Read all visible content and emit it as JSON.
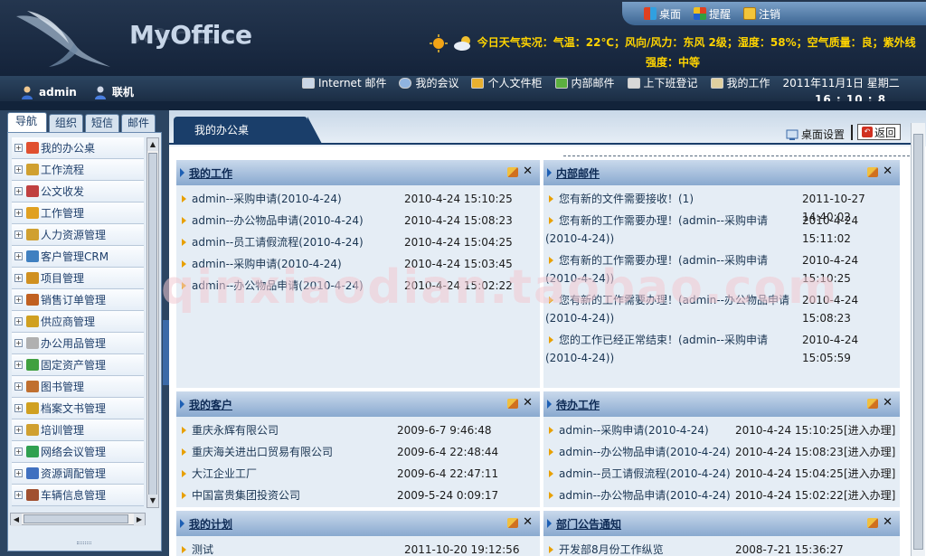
{
  "header": {
    "logo_text": "MyOffice",
    "top_links": {
      "desktop": "桌面",
      "reminder": "提醒",
      "logout": "注销"
    },
    "weather": "今日天气实况：气温：22℃；风向/风力：东风 2级；湿度：58%；空气质量：良；紫外线强度：中等"
  },
  "navbar": {
    "username": "admin",
    "status": "联机",
    "links": [
      "Internet 邮件",
      "我的会议",
      "个人文件柜",
      "内部邮件",
      "上下班登记",
      "我的工作"
    ],
    "date": "2011年11月1日 星期二",
    "clock": "16 : 10 : 8"
  },
  "sidebar": {
    "tabs": [
      "导航",
      "组织",
      "短信",
      "邮件"
    ],
    "modules": [
      "我的办公桌",
      "工作流程",
      "公文收发",
      "工作管理",
      "人力资源管理",
      "客户管理CRM",
      "项目管理",
      "销售订单管理",
      "供应商管理",
      "办公用品管理",
      "固定资产管理",
      "图书管理",
      "档案文书管理",
      "培训管理",
      "网络会议管理",
      "资源调配管理",
      "车辆信息管理"
    ]
  },
  "main": {
    "tab_title": "我的办公桌",
    "desk_settings": "桌面设置",
    "back": "返回",
    "panels": {
      "my_work": {
        "title": "我的工作",
        "rows": [
          {
            "text": "admin--采购申请(2010-4-24)",
            "time": "2010-4-24 15:10:25"
          },
          {
            "text": "admin--办公物品申请(2010-4-24)",
            "time": "2010-4-24 15:08:23"
          },
          {
            "text": "admin--员工请假流程(2010-4-24)",
            "time": "2010-4-24 15:04:25"
          },
          {
            "text": "admin--采购申请(2010-4-24)",
            "time": "2010-4-24 15:03:45"
          },
          {
            "text": "admin--办公物品申请(2010-4-24)",
            "time": "2010-4-24 15:02:22"
          }
        ]
      },
      "internal_mail": {
        "title": "内部邮件",
        "rows": [
          {
            "text": "您有新的文件需要接收！(1)",
            "time": "2011-10-27 14:40:02"
          },
          {
            "text": "您有新的工作需要办理！(admin--采购申请(2010-4-24))",
            "time": "2010-4-24 15:11:02"
          },
          {
            "text": "您有新的工作需要办理！(admin--采购申请(2010-4-24))",
            "time": "2010-4-24 15:10:25"
          },
          {
            "text": "您有新的工作需要办理！(admin--办公物品申请(2010-4-24))",
            "time": "2010-4-24 15:08:23"
          },
          {
            "text": "您的工作已经正常结束！(admin--采购申请(2010-4-24))",
            "time": "2010-4-24 15:05:59"
          }
        ]
      },
      "my_customers": {
        "title": "我的客户",
        "rows": [
          {
            "text": "重庆永辉有限公司",
            "time": "2009-6-7 9:46:48"
          },
          {
            "text": "重庆海关进出口贸易有限公司",
            "time": "2009-6-4 22:48:44"
          },
          {
            "text": "大江企业工厂",
            "time": "2009-6-4 22:47:11"
          },
          {
            "text": "中国富贵集团投资公司",
            "time": "2009-5-24 0:09:17"
          }
        ]
      },
      "todo": {
        "title": "待办工作",
        "action": "[进入办理]",
        "rows": [
          {
            "text": "admin--采购申请(2010-4-24)",
            "time": "2010-4-24 15:10:25"
          },
          {
            "text": "admin--办公物品申请(2010-4-24)",
            "time": "2010-4-24 15:08:23"
          },
          {
            "text": "admin--员工请假流程(2010-4-24)",
            "time": "2010-4-24 15:04:25"
          },
          {
            "text": "admin--办公物品申请(2010-4-24)",
            "time": "2010-4-24 15:02:22"
          }
        ]
      },
      "my_plan": {
        "title": "我的计划",
        "rows": [
          {
            "text": "测试",
            "time": "2011-10-20 19:12:56"
          }
        ]
      },
      "dept_notice": {
        "title": "部门公告通知",
        "rows": [
          {
            "text": "开发部8月份工作纵览",
            "time": "2008-7-21 15:36:27"
          }
        ]
      }
    }
  },
  "watermark": "qinxiaodian.taobao.com",
  "colors": {
    "header_bg": "#1b2d44",
    "panel_header": "#89a9cf",
    "bullet": "#e8a000",
    "weather": "#ffd400",
    "accent": "#1a3e6a"
  }
}
